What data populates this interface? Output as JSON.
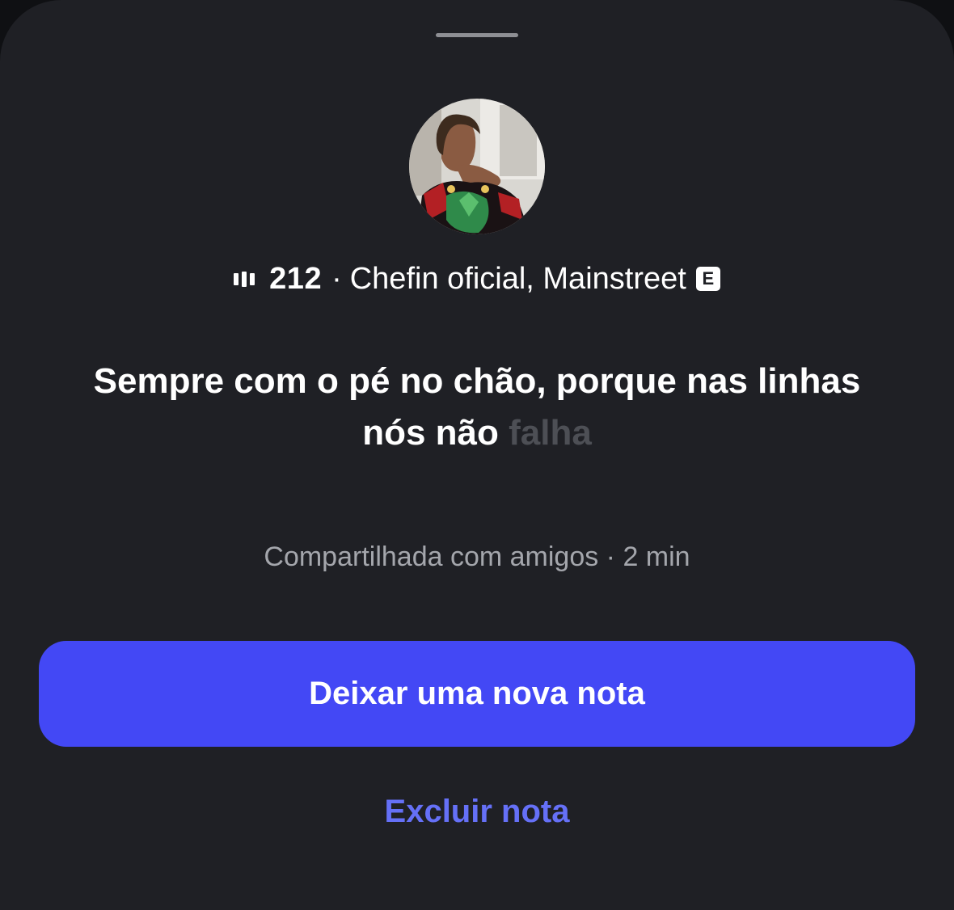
{
  "note": {
    "music": {
      "icon": "audio-bars-icon",
      "count": "212",
      "separator": "·",
      "track": "Chefin oficial, Mainstreet",
      "explicit_badge": "E"
    },
    "text_main": "Sempre com o pé no chão, porque nas linhas nós não ",
    "text_faded": "falha",
    "shared_info": "Compartilhada com amigos · 2 min"
  },
  "actions": {
    "new_note_label": "Deixar uma nova nota",
    "delete_label": "Excluir nota"
  },
  "colors": {
    "sheet_background": "#1f2025",
    "primary_button": "#4348f5",
    "delete_link": "#6570f7",
    "secondary_text": "#a4a6ac"
  }
}
